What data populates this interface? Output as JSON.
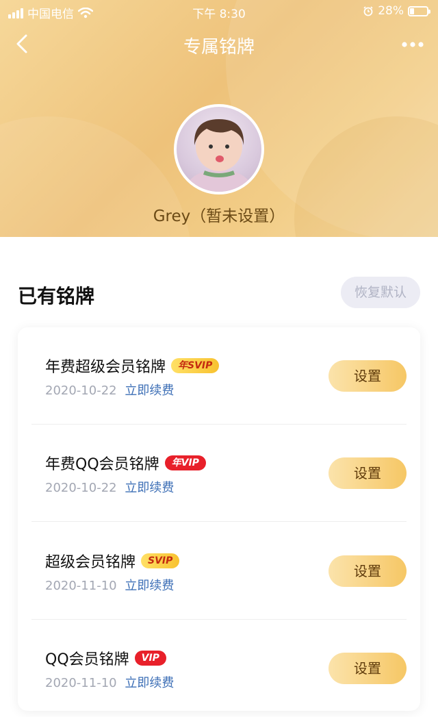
{
  "status_bar": {
    "carrier": "中国电信",
    "time": "下午 8:30",
    "battery_percent": "28%",
    "battery_level": 0.28,
    "icons": [
      "signal-icon",
      "wifi-icon",
      "alarm-icon",
      "battery-icon"
    ]
  },
  "nav": {
    "title": "专属铭牌",
    "back_icon": "chevron-left-icon",
    "more_icon": "more-dots-icon"
  },
  "profile": {
    "name": "Grey（暂未设置）"
  },
  "section": {
    "title": "已有铭牌",
    "reset_label": "恢复默认"
  },
  "colors": {
    "header": "#eec27a",
    "button_gold": "#f6c765",
    "link_blue": "#3d6fb6",
    "badge_red": "#e8202a"
  },
  "nameplates": [
    {
      "name": "年费超级会员铭牌",
      "badge": "年SVIP",
      "badge_style": "gold",
      "date": "2020-10-22",
      "renew": "立即续费",
      "button": "设置"
    },
    {
      "name": "年费QQ会员铭牌",
      "badge": "年VIP",
      "badge_style": "red",
      "date": "2020-10-22",
      "renew": "立即续费",
      "button": "设置"
    },
    {
      "name": "超级会员铭牌",
      "badge": "SVIP",
      "badge_style": "gold",
      "date": "2020-11-10",
      "renew": "立即续费",
      "button": "设置"
    },
    {
      "name": "QQ会员铭牌",
      "badge": "VIP",
      "badge_style": "red",
      "date": "2020-11-10",
      "renew": "立即续费",
      "button": "设置"
    }
  ]
}
